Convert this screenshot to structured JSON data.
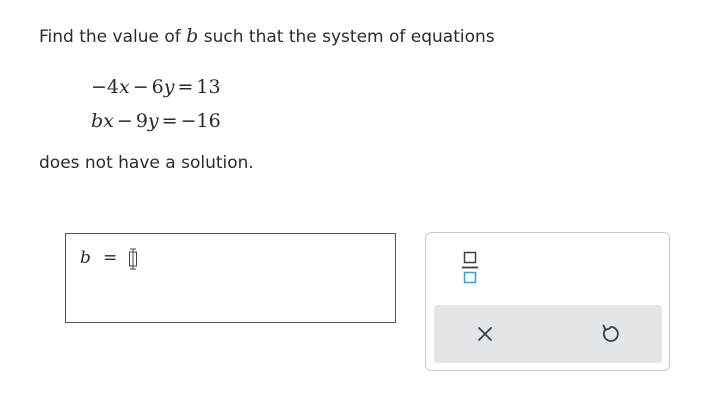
{
  "question": {
    "prompt_before": "Find the value of ",
    "prompt_var": "b",
    "prompt_after": " such that the system of equations",
    "equations": [
      {
        "parts": [
          "−4",
          "x",
          "−",
          "6",
          "y",
          "=",
          "13"
        ]
      },
      {
        "parts": [
          "b",
          "x",
          "−",
          "9",
          "y",
          "=",
          "−",
          "16"
        ]
      }
    ],
    "conclusion": "does not have a solution."
  },
  "answer": {
    "variable": "b",
    "equals": "=",
    "value": ""
  },
  "toolbox": {
    "fraction_icon": "fraction-icon",
    "clear_icon": "close-icon",
    "undo_icon": "undo-icon",
    "accent_color": "#2aa3d8",
    "icon_color": "#3a3f45"
  }
}
